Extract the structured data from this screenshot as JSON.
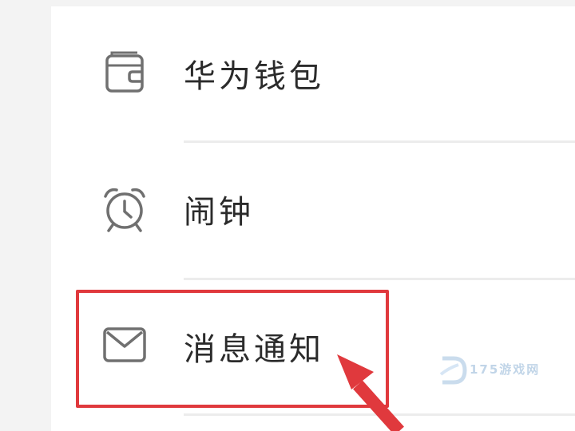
{
  "menu": {
    "items": [
      {
        "label": "华为钱包",
        "icon": "wallet-icon"
      },
      {
        "label": "闹钟",
        "icon": "alarm-clock-icon"
      },
      {
        "label": "消息通知",
        "icon": "mail-icon"
      }
    ]
  },
  "highlight": {
    "color": "#e0393d",
    "target_index": 2
  },
  "watermark": {
    "text": "175游戏网"
  },
  "colors": {
    "background": "#f3f3f3",
    "card": "#ffffff",
    "icon_stroke": "#707070",
    "text": "#2b2b2b",
    "accent": "#e0393d"
  }
}
